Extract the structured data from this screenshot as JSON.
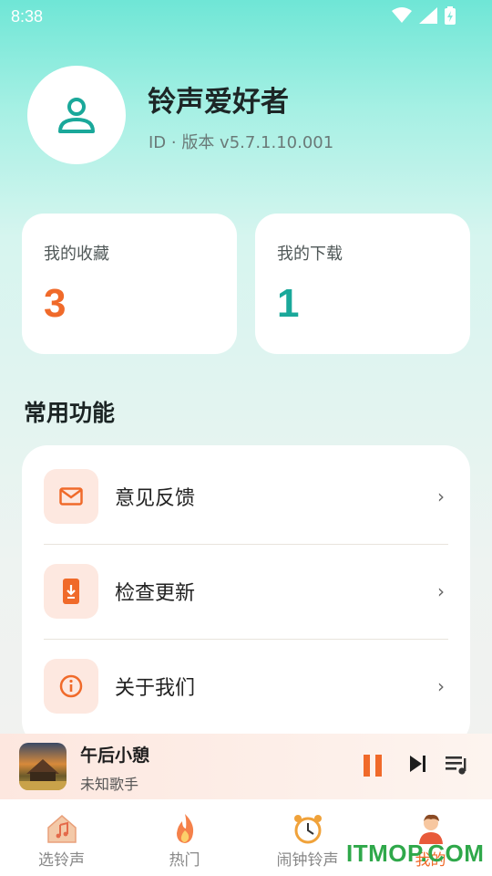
{
  "status_bar": {
    "time": "8:38"
  },
  "profile": {
    "name": "铃声爱好者",
    "id_line": "ID · 版本 v5.7.1.10.001"
  },
  "stats": [
    {
      "label": "我的收藏",
      "value": "3",
      "color": "#f06a2a"
    },
    {
      "label": "我的下载",
      "value": "1",
      "color": "#1aa89a"
    }
  ],
  "section_title": "常用功能",
  "functions": [
    {
      "label": "意见反馈",
      "icon": "mail-icon",
      "chevron": "›"
    },
    {
      "label": "检查更新",
      "icon": "phone-download-icon",
      "chevron": "›"
    },
    {
      "label": "关于我们",
      "icon": "info-icon",
      "chevron": "›"
    }
  ],
  "player": {
    "song": "午后小憩",
    "artist": "未知歌手",
    "state": "playing"
  },
  "tabs": [
    {
      "label": "选铃声",
      "icon": "house-music-icon",
      "active": false
    },
    {
      "label": "热门",
      "icon": "flame-icon",
      "active": false
    },
    {
      "label": "闹钟铃声",
      "icon": "alarm-clock-icon",
      "active": false
    },
    {
      "label": "我的",
      "icon": "person-icon",
      "active": true
    }
  ],
  "watermark": "ITMOP.COM",
  "colors": {
    "accent_orange": "#f06a2a",
    "accent_teal": "#1aa89a",
    "icon_bg": "#fde8e0"
  }
}
